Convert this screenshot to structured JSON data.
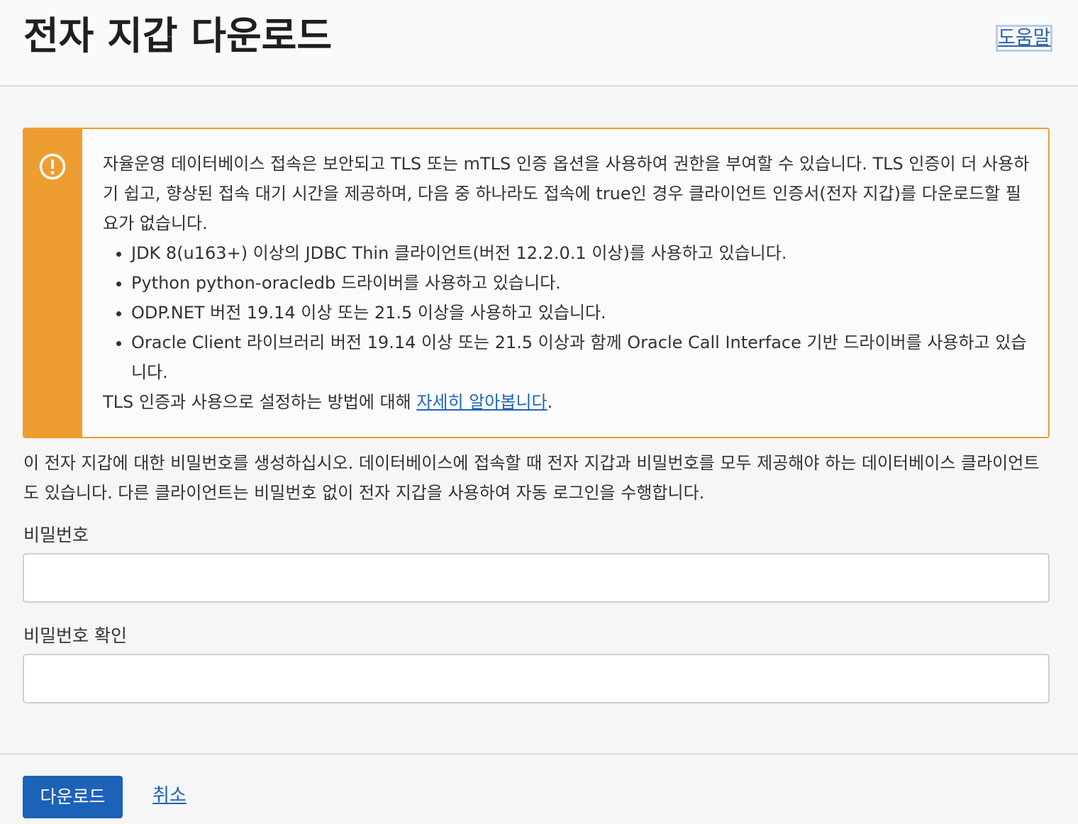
{
  "header": {
    "title": "전자 지갑 다운로드",
    "help_label": "도움말"
  },
  "alert": {
    "icon": "exclamation-circle-icon",
    "accent_color": "#ee9e31",
    "intro": "자율운영 데이터베이스 접속은 보안되고 TLS 또는 mTLS 인증 옵션을 사용하여 권한을 부여할 수 있습니다. TLS 인증이 더 사용하기 쉽고, 향상된 접속 대기 시간을 제공하며, 다음 중 하나라도 접속에 true인 경우 클라이언트 인증서(전자 지갑)를 다운로드할 필요가 없습니다.",
    "items": [
      "JDK 8(u163+) 이상의 JDBC Thin 클라이언트(버전 12.2.0.1 이상)를 사용하고 있습니다.",
      "Python python-oracledb 드라이버를 사용하고 있습니다.",
      "ODP.NET 버전 19.14 이상 또는 21.5 이상을 사용하고 있습니다.",
      "Oracle Client 라이브러리 버전 19.14 이상 또는 21.5 이상과 함께 Oracle Call Interface 기반 드라이버를 사용하고 있습니다."
    ],
    "outro_prefix": "TLS 인증과 사용으로 설정하는 방법에 대해 ",
    "learn_more_label": "자세히 알아봅니다",
    "outro_suffix": "."
  },
  "description": "이 전자 지갑에 대한 비밀번호를 생성하십시오. 데이터베이스에 접속할 때 전자 지갑과 비밀번호를 모두 제공해야 하는 데이터베이스 클라이언트도 있습니다. 다른 클라이언트는 비밀번호 없이 전자 지갑을 사용하여 자동 로그인을 수행합니다.",
  "form": {
    "password_label": "비밀번호",
    "password_value": "",
    "confirm_label": "비밀번호 확인",
    "confirm_value": ""
  },
  "footer": {
    "download_label": "다운로드",
    "cancel_label": "취소",
    "primary_color": "#1c62b9"
  }
}
